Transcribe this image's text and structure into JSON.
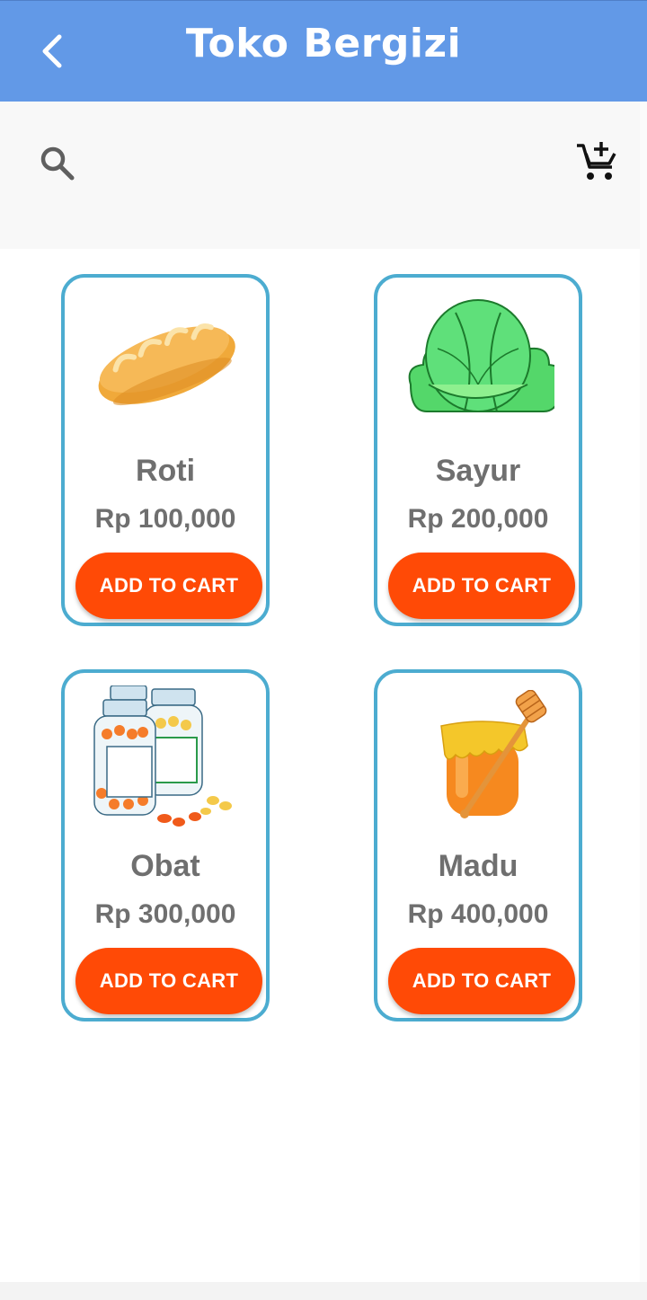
{
  "appbar": {
    "title": "Toko Bergizi",
    "back_icon": "arrow-back-icon",
    "background_color": "#6299e7"
  },
  "toolbar": {
    "search_icon": "search-icon",
    "cart_icon": "add-shopping-cart-icon"
  },
  "products": [
    {
      "name": "Roti",
      "price": "Rp 100,000",
      "button_label": "ADD TO CART",
      "image": "bread-image"
    },
    {
      "name": "Sayur",
      "price": "Rp 200,000",
      "button_label": "ADD TO CART",
      "image": "cabbage-image"
    },
    {
      "name": "Obat",
      "price": "Rp 300,000",
      "button_label": "ADD TO CART",
      "image": "medicine-bottles-image"
    },
    {
      "name": "Madu",
      "price": "Rp 400,000",
      "button_label": "ADD TO CART",
      "image": "honey-jar-image"
    }
  ],
  "colors": {
    "card_border": "#4cacd0",
    "button": "#ff4a06",
    "text_gray": "#6f6f6f"
  }
}
